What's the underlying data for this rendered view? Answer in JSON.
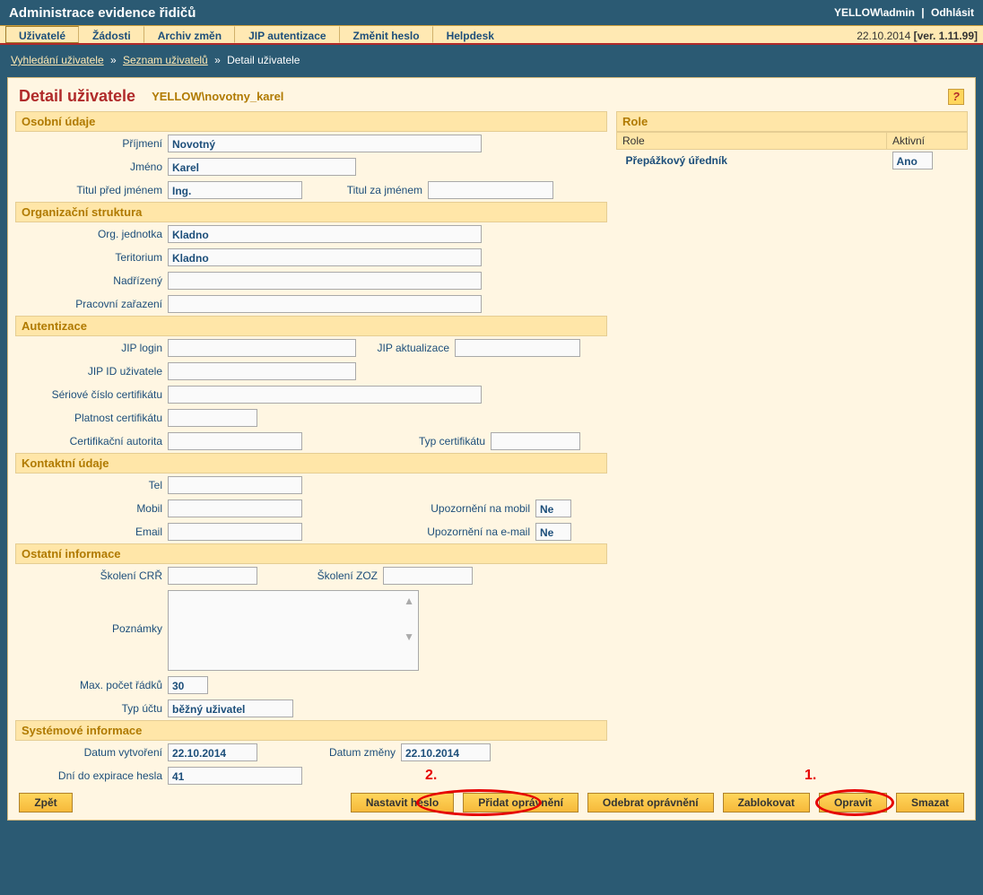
{
  "header": {
    "app_title": "Administrace evidence řidičů",
    "user": "YELLOW\\admin",
    "sep": "|",
    "logout": "Odhlásit"
  },
  "nav": {
    "tabs": [
      "Uživatelé",
      "Žádosti",
      "Archiv změn",
      "JIP autentizace",
      "Změnit heslo",
      "Helpdesk"
    ],
    "active_index": 0,
    "date": "22.10.2014",
    "version_label": "[ver. 1.11.99]"
  },
  "breadcrumb": {
    "a": "Vyhledání uživatele",
    "b": "Seznam uživatelů",
    "c": "Detail uživatele"
  },
  "page": {
    "title": "Detail uživatele",
    "subtitle": "YELLOW\\novotny_karel",
    "help": "?"
  },
  "sections": {
    "personal": {
      "head": "Osobní údaje",
      "labels": {
        "surname": "Příjmení",
        "firstname": "Jméno",
        "title_before": "Titul před jménem",
        "title_after": "Titul za jménem"
      },
      "values": {
        "surname": "Novotný",
        "firstname": "Karel",
        "title_before": "Ing.",
        "title_after": ""
      }
    },
    "org": {
      "head": "Organizační struktura",
      "labels": {
        "unit": "Org. jednotka",
        "territory": "Teritorium",
        "superior": "Nadřízený",
        "assignment": "Pracovní zařazení"
      },
      "values": {
        "unit": "Kladno",
        "territory": "Kladno",
        "superior": "",
        "assignment": ""
      }
    },
    "auth": {
      "head": "Autentizace",
      "labels": {
        "jip_login": "JIP login",
        "jip_upd": "JIP aktualizace",
        "jip_id": "JIP ID uživatele",
        "cert_serial": "Sériové číslo certifikátu",
        "cert_valid": "Platnost certifikátu",
        "cert_auth": "Certifikační autorita",
        "cert_type": "Typ certifikátu"
      },
      "values": {
        "jip_login": "",
        "jip_upd": "",
        "jip_id": "",
        "cert_serial": "",
        "cert_valid": "",
        "cert_auth": "",
        "cert_type": ""
      }
    },
    "contact": {
      "head": "Kontaktní údaje",
      "labels": {
        "tel": "Tel",
        "mobile": "Mobil",
        "mobile_notify": "Upozornění na mobil",
        "email": "Email",
        "email_notify": "Upozornění na e-mail"
      },
      "values": {
        "tel": "",
        "mobile": "",
        "mobile_notify": "Ne",
        "email": "",
        "email_notify": "Ne"
      }
    },
    "other": {
      "head": "Ostatní informace",
      "labels": {
        "training_crr": "Školení CRŘ",
        "training_zoz": "Školení ZOZ",
        "notes": "Poznámky",
        "max_rows": "Max. počet řádků",
        "acct_type": "Typ účtu"
      },
      "values": {
        "training_crr": "",
        "training_zoz": "",
        "notes": "",
        "max_rows": "30",
        "acct_type": "běžný uživatel"
      }
    },
    "system": {
      "head": "Systémové informace",
      "labels": {
        "created": "Datum vytvoření",
        "changed": "Datum změny",
        "pwd_expire": "Dní do expirace hesla"
      },
      "values": {
        "created": "22.10.2014",
        "changed": "22.10.2014",
        "pwd_expire": "41"
      }
    }
  },
  "roles": {
    "head": "Role",
    "col_role": "Role",
    "col_active": "Aktivní",
    "rows": [
      {
        "role": "Přepážkový úředník",
        "active": "Ano"
      }
    ]
  },
  "buttons": {
    "back": "Zpět",
    "set_password": "Nastavit heslo",
    "add_perm": "Přidat oprávnění",
    "remove_perm": "Odebrat oprávnění",
    "block": "Zablokovat",
    "edit": "Opravit",
    "delete": "Smazat"
  },
  "annotations": {
    "a1": "1.",
    "a2": "2."
  }
}
